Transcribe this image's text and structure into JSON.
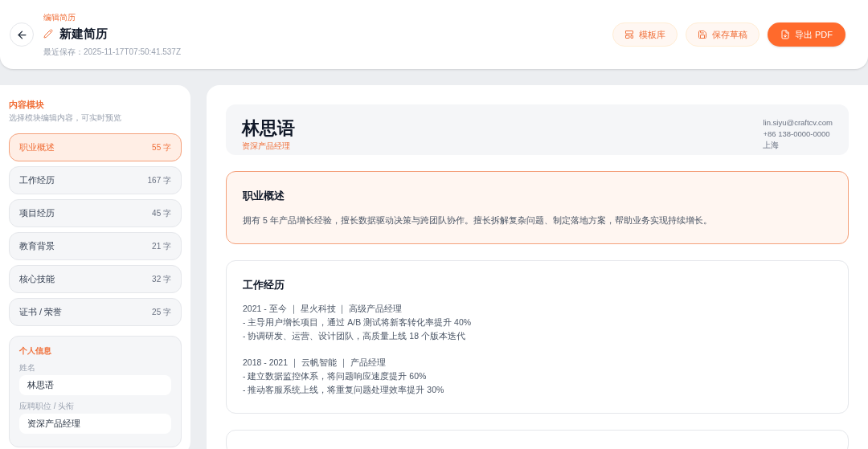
{
  "header": {
    "eyebrow": "编辑简历",
    "title": "新建简历",
    "saved": "最近保存：2025-11-17T07:50:41.537Z",
    "buttons": [
      {
        "kind": "templates",
        "label": "模板库"
      },
      {
        "kind": "draft",
        "label": "保存草稿"
      },
      {
        "kind": "export",
        "label": "导出 PDF"
      }
    ]
  },
  "sidebar": {
    "title": "内容模块",
    "subtitle": "选择模块编辑内容，可实时预览",
    "modules": [
      {
        "label": "职业概述",
        "count": "55 字",
        "selected": true
      },
      {
        "label": "工作经历",
        "count": "167 字",
        "selected": false
      },
      {
        "label": "项目经历",
        "count": "45 字",
        "selected": false
      },
      {
        "label": "教育背景",
        "count": "21 字",
        "selected": false
      },
      {
        "label": "核心技能",
        "count": "32 字",
        "selected": false
      },
      {
        "label": "证书 / 荣誉",
        "count": "25 字",
        "selected": false
      }
    ],
    "personal": {
      "title": "个人信息",
      "fields": [
        {
          "label": "姓名",
          "value": "林思语"
        },
        {
          "label": "应聘职位 / 头衔",
          "value": "资深产品经理"
        }
      ]
    }
  },
  "preview": {
    "name": "林思语",
    "role": "资深产品经理",
    "contact": [
      "lin.siyu@craftcv.com",
      "+86 138-0000-0000",
      "上海"
    ],
    "sections": [
      {
        "title": "职业概述",
        "selected": true,
        "blocks": [
          [
            "拥有 5 年产品增长经验，擅长数据驱动决策与跨团队协作。擅长拆解复杂问题、制定落地方案，帮助业务实现持续增长。"
          ]
        ]
      },
      {
        "title": "工作经历",
        "selected": false,
        "blocks": [
          [
            "2021 - 至今 ｜ 星火科技 ｜ 高级产品经理",
            "- 主导用户增长项目，通过 A/B 测试将新客转化率提升 40%",
            "- 协调研发、运营、设计团队，高质量上线 18 个版本迭代"
          ],
          [
            "2018 - 2021 ｜ 云帆智能 ｜ 产品经理",
            "- 建立数据监控体系，将问题响应速度提升 60%",
            "- 推动客服系统上线，将重复问题处理效率提升 30%"
          ]
        ]
      }
    ]
  }
}
